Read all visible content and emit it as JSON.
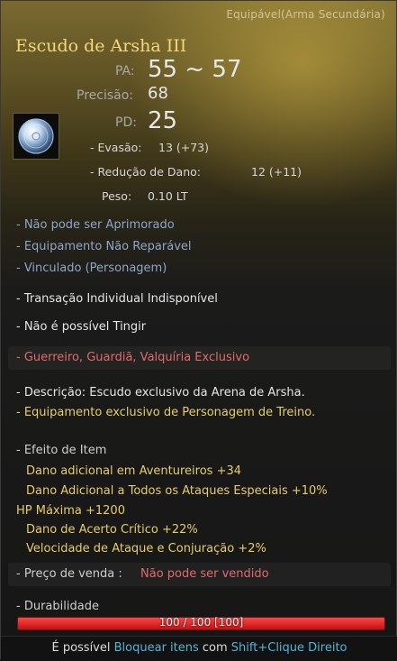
{
  "header": {
    "equip_type": "Equipável(Arma Secundária)",
    "item_name": "Escudo de Arsha III"
  },
  "icon": {
    "name": "shield-item-icon"
  },
  "stats": {
    "ap_label": "PA:",
    "ap_value": "55 ~ 57",
    "accuracy_label": "Precisão:",
    "accuracy_value": "68",
    "dp_label": "PD:",
    "dp_value": "25",
    "evasion_label": "- Evasão:",
    "evasion_value": "13 (+73)",
    "damage_reduction_label": "- Redução de Dano:",
    "damage_reduction_value": "12 (+11)",
    "weight_label": "Peso:",
    "weight_value": "0.10 LT"
  },
  "properties": [
    "- Não pode ser Aprimorado",
    "- Equipamento Não Reparável",
    "- Vinculado (Personagem)"
  ],
  "restrictions": {
    "trade": "- Transação Individual Indisponível",
    "dye": "- Não é possível Tingir",
    "class": "- Guerreiro, Guardiã, Valquíria Exclusivo"
  },
  "description": {
    "line1": "- Descrição: Escudo exclusivo da Arena de Arsha.",
    "line2": "- Equipamento exclusivo de Personagem de Treino."
  },
  "item_effects": {
    "heading": "- Efeito de Item",
    "lines": [
      "Dano adicional em Aventureiros +34",
      "Dano Adicional a Todos os Ataques Especiais +10%"
    ],
    "hp_line": "HP Máxima +1200",
    "lines2": [
      "Dano de Acerto Crítico +22%",
      "Velocidade de Ataque e Conjuração +2%"
    ]
  },
  "sale": {
    "label": "- Preço de venda :",
    "value": "Não pode ser vendido"
  },
  "durability": {
    "label": "- Durabilidade",
    "text": "100 / 100  [100]",
    "fraction": 1.0
  },
  "footer": {
    "prefix": "É possível ",
    "action": "Bloquear itens",
    "middle": " com ",
    "shortcut": "Shift+Clique Direito"
  },
  "colors": {
    "title": "#f4d87b",
    "blue_property": "#8fa6c8",
    "red_restriction": "#e06b6b",
    "yellow_effect": "#e7cc6b",
    "durability_fill": "#e02020",
    "footer_highlight": "#56b4d6"
  }
}
